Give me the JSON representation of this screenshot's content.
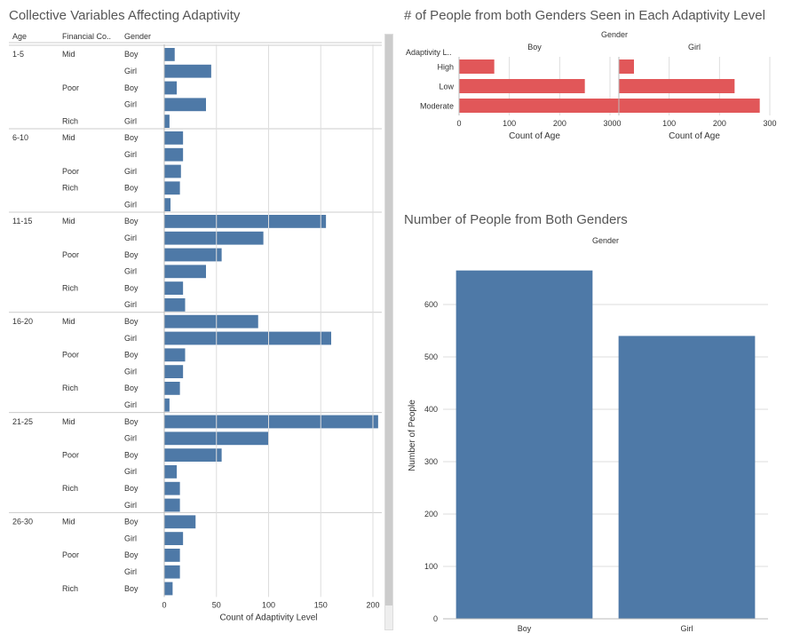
{
  "chart_data": [
    {
      "id": "adaptivity_by_gender",
      "type": "bar",
      "title": "# of People from both Genders Seen in Each Adaptivity Level",
      "facet_label": "Gender",
      "row_dim_label": "Adaptivity L..",
      "xlabel": "Count of Age",
      "categories": [
        "High",
        "Low",
        "Moderate"
      ],
      "facets": [
        "Boy",
        "Girl"
      ],
      "series": [
        {
          "name": "Boy",
          "values": [
            70,
            250,
            350
          ]
        },
        {
          "name": "Girl",
          "values": [
            30,
            230,
            280
          ]
        }
      ],
      "xlim": [
        0,
        300
      ],
      "xticks": [
        0,
        100,
        200,
        300
      ]
    },
    {
      "id": "people_by_gender",
      "type": "bar",
      "title": "Number of People from Both Genders",
      "xlabel": "Gender",
      "ylabel": "Number of People",
      "categories": [
        "Boy",
        "Girl"
      ],
      "values": [
        665,
        540
      ],
      "ylim": [
        0,
        600
      ],
      "yticks": [
        0,
        100,
        200,
        300,
        400,
        500,
        600
      ]
    },
    {
      "id": "collective_variables",
      "type": "bar",
      "title": "Collective Variables Affecting Adaptivity",
      "row_headers": [
        "Age",
        "Financial Co..",
        "Gender"
      ],
      "xlabel": "Count of Adaptivity Level",
      "xlim": [
        0,
        200
      ],
      "xticks": [
        0,
        50,
        100,
        150,
        200
      ],
      "rows": [
        {
          "age": "1-5",
          "fin": "Mid",
          "gender": "Boy",
          "value": 10
        },
        {
          "age": "",
          "fin": "",
          "gender": "Girl",
          "value": 45
        },
        {
          "age": "",
          "fin": "Poor",
          "gender": "Boy",
          "value": 12
        },
        {
          "age": "",
          "fin": "",
          "gender": "Girl",
          "value": 40
        },
        {
          "age": "",
          "fin": "Rich",
          "gender": "Girl",
          "value": 5
        },
        {
          "age": "6-10",
          "fin": "Mid",
          "gender": "Boy",
          "value": 18
        },
        {
          "age": "",
          "fin": "",
          "gender": "Girl",
          "value": 18
        },
        {
          "age": "",
          "fin": "Poor",
          "gender": "Girl",
          "value": 16
        },
        {
          "age": "",
          "fin": "Rich",
          "gender": "Boy",
          "value": 15
        },
        {
          "age": "",
          "fin": "",
          "gender": "Girl",
          "value": 6
        },
        {
          "age": "11-15",
          "fin": "Mid",
          "gender": "Boy",
          "value": 155
        },
        {
          "age": "",
          "fin": "",
          "gender": "Girl",
          "value": 95
        },
        {
          "age": "",
          "fin": "Poor",
          "gender": "Boy",
          "value": 55
        },
        {
          "age": "",
          "fin": "",
          "gender": "Girl",
          "value": 40
        },
        {
          "age": "",
          "fin": "Rich",
          "gender": "Boy",
          "value": 18
        },
        {
          "age": "",
          "fin": "",
          "gender": "Girl",
          "value": 20
        },
        {
          "age": "16-20",
          "fin": "Mid",
          "gender": "Boy",
          "value": 90
        },
        {
          "age": "",
          "fin": "",
          "gender": "Girl",
          "value": 160
        },
        {
          "age": "",
          "fin": "Poor",
          "gender": "Boy",
          "value": 20
        },
        {
          "age": "",
          "fin": "",
          "gender": "Girl",
          "value": 18
        },
        {
          "age": "",
          "fin": "Rich",
          "gender": "Boy",
          "value": 15
        },
        {
          "age": "",
          "fin": "",
          "gender": "Girl",
          "value": 5
        },
        {
          "age": "21-25",
          "fin": "Mid",
          "gender": "Boy",
          "value": 205
        },
        {
          "age": "",
          "fin": "",
          "gender": "Girl",
          "value": 100
        },
        {
          "age": "",
          "fin": "Poor",
          "gender": "Boy",
          "value": 55
        },
        {
          "age": "",
          "fin": "",
          "gender": "Girl",
          "value": 12
        },
        {
          "age": "",
          "fin": "Rich",
          "gender": "Boy",
          "value": 15
        },
        {
          "age": "",
          "fin": "",
          "gender": "Girl",
          "value": 15
        },
        {
          "age": "26-30",
          "fin": "Mid",
          "gender": "Boy",
          "value": 30
        },
        {
          "age": "",
          "fin": "",
          "gender": "Girl",
          "value": 18
        },
        {
          "age": "",
          "fin": "Poor",
          "gender": "Boy",
          "value": 15
        },
        {
          "age": "",
          "fin": "",
          "gender": "Girl",
          "value": 15
        },
        {
          "age": "",
          "fin": "Rich",
          "gender": "Boy",
          "value": 8
        }
      ]
    }
  ]
}
